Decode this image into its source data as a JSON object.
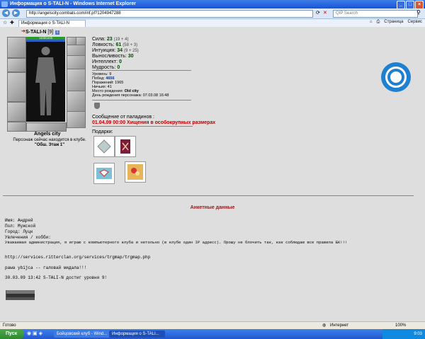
{
  "window": {
    "title": "Информация о S-TALI-N - Windows Internet Explorer"
  },
  "address": {
    "url": "http://angelscity.combats.com/inf.pl?1204947288"
  },
  "search": {
    "placeholder": "QIP Search"
  },
  "tabs": [
    {
      "label": "Информация о S-TALI-N"
    }
  ],
  "toolbar": {
    "page_label": "Страница",
    "tools_label": "Сервис"
  },
  "character": {
    "name": "S-TALI-N",
    "level_badge": "[9]",
    "hp": "1405/1405",
    "city": "Angels city",
    "location_note": "Персонаж сейчас находится в клубе.",
    "room": "\"Обш. Этаж 1\""
  },
  "stats": [
    {
      "label": "Сила:",
      "value": "23",
      "bonus": "(19 + 4)"
    },
    {
      "label": "Ловкость:",
      "value": "61",
      "bonus": "(58 + 3)"
    },
    {
      "label": "Интуиция:",
      "value": "34",
      "bonus": "(9 + 25)"
    },
    {
      "label": "Выносливость:",
      "value": "30",
      "bonus": ""
    },
    {
      "label": "Интеллект:",
      "value": "0",
      "bonus": ""
    },
    {
      "label": "Мудрость:",
      "value": "0",
      "bonus": ""
    }
  ],
  "info": {
    "level": {
      "label": "Уровень:",
      "value": "9"
    },
    "wins": {
      "label": "Побед:",
      "value": "4656"
    },
    "losses": {
      "label": "Поражений:",
      "value": "1965"
    },
    "draws": {
      "label": "Ничьих:",
      "value": "41"
    },
    "birthplace": {
      "label": "Место рождения:",
      "value": "Old city"
    },
    "birthday": {
      "label": "День рождения персонажа:",
      "value": "07.03.08 16:48"
    }
  },
  "paladins": {
    "title": "Сообщение от паладинов :",
    "message": "01.04.09 00:00 Хищения в особокрупных размерах"
  },
  "gifts": {
    "label": "Подарки:"
  },
  "anketa": {
    "title": "Анкетные данные",
    "name_line": "Имя: Андрей",
    "gender_line": "Пол: Мужской",
    "city_line": "Город: Луцк",
    "hobby_line": "Увлечения / хобби:",
    "hobby_text": "Уважаемая администрация, я играю с компьютерного клуба и нетольно (в клубе один IP адресс). Прошу не блочить так, как соблюдаю все правила БК!!!",
    "link_line": "http://services.ritterclan.org/services/trgmap/trgmap.php",
    "quote_line": "pawa ybijca   -- галовай мидала!!!",
    "event_line": "30.03.09 13:42 S-TALI-N достиг уровня 9!"
  },
  "status_bar": {
    "left": "Готово",
    "zone": "Интернет",
    "zoom": "100%"
  },
  "taskbar": {
    "start": "Пуск",
    "items": [
      "Бойцовский клуб - Wind...",
      "Информация о S-TALI..."
    ],
    "clock": "9:03"
  },
  "colors": {
    "accent": "#1f7fd0",
    "alert": "#c00000",
    "section_title": "#8b1a1a"
  },
  "icons": {
    "logo": "angels-city-logo",
    "shield": "clan-shield-icon"
  }
}
